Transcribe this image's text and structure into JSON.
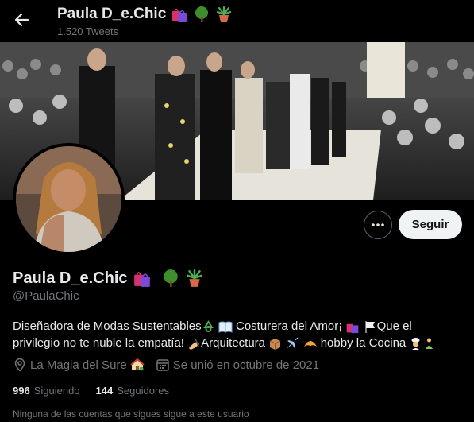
{
  "header": {
    "name": "Paula D_e.Chic",
    "tweet_count": "1.520 Tweets"
  },
  "profile": {
    "display_name": "Paula D_e.Chic",
    "handle": "@PaulaChic",
    "bio": {
      "line1_a": "Diseñadora de Modas Sustentables",
      "line1_b": " Costurera del Amor¡ ",
      "line1_c": "Que el",
      "line2_a": "privilegio no te nuble la empatía! ",
      "line2_b": "Arquitectura ",
      "line2_c": " hobby la Cocina "
    },
    "location": "La Magia del Sure",
    "joined": "Se unió en octubre de 2021",
    "following_count": "996",
    "following_label": "Siguiendo",
    "followers_count": "144",
    "followers_label": "Seguidores",
    "followers_you_know": "Ninguna de las cuentas que sigues sigue a este usuario"
  },
  "actions": {
    "follow_label": "Seguir"
  },
  "icons": [
    "back-arrow-icon",
    "shopping-bags-icon",
    "tree-icon",
    "potted-plant-icon",
    "recycle-icon",
    "book-icon",
    "white-flag-icon",
    "writing-hand-icon",
    "package-icon",
    "airplane-icon",
    "croissant-icon",
    "cook-icon",
    "meditation-icon",
    "location-icon",
    "house-icon",
    "calendar-icon",
    "more-icon"
  ],
  "colors": {
    "background": "#000000",
    "text": "#e7e9ea",
    "secondary": "#71767b",
    "button_bg": "#eff3f4"
  }
}
